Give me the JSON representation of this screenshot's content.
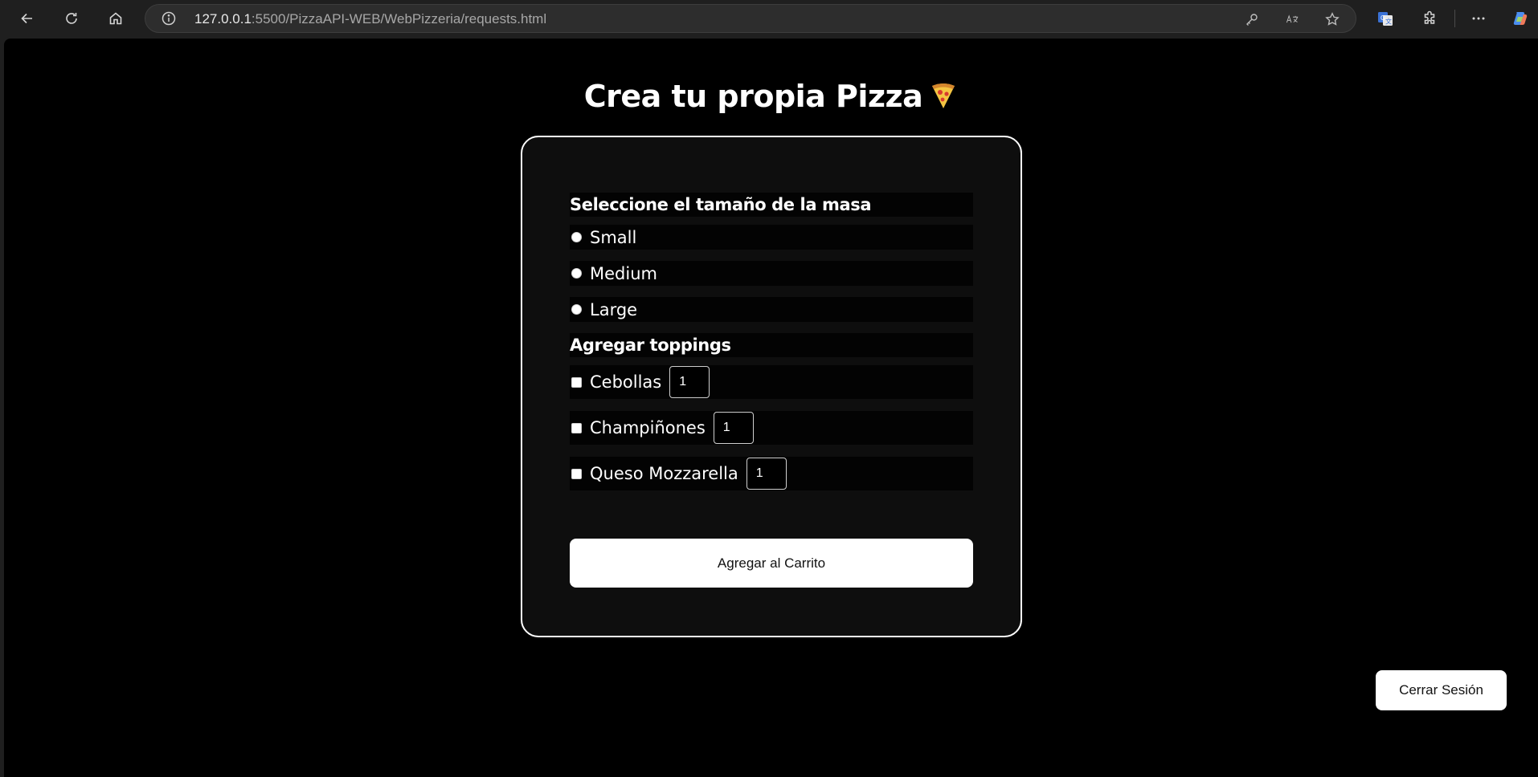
{
  "browser": {
    "url_host": "127.0.0.1",
    "url_rest": ":5500/PizzaAPI-WEB/WebPizzeria/requests.html"
  },
  "page": {
    "title": "Crea tu propia Pizza"
  },
  "form": {
    "size_heading": "Seleccione el tamaño de la masa",
    "sizes": [
      "Small",
      "Medium",
      "Large"
    ],
    "toppings_heading": "Agregar toppings",
    "toppings": [
      {
        "label": "Cebollas",
        "quantity": "1"
      },
      {
        "label": "Champiñones",
        "quantity": "1"
      },
      {
        "label": "Queso Mozzarella",
        "quantity": "1"
      }
    ],
    "submit_label": "Agregar al Carrito"
  },
  "logout_label": "Cerrar Sesión"
}
